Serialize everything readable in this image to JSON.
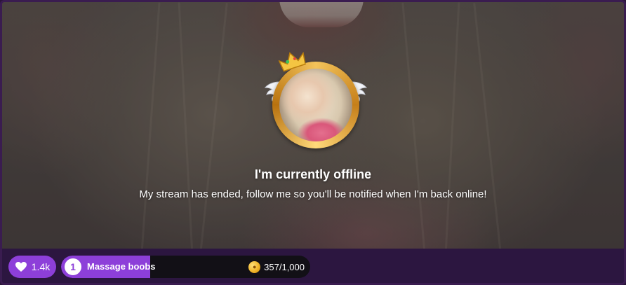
{
  "offline": {
    "title": "I'm currently offline",
    "message": "My stream has ended, follow me so you'll be notified when I'm back online!"
  },
  "likes": {
    "count": "1.4k",
    "icon": "heart-icon"
  },
  "goal": {
    "number": "1",
    "label": "Massage boobs",
    "progress_text": "357/1,000",
    "progress_fraction": 0.357,
    "coin_icon": "coin-icon"
  },
  "colors": {
    "accent": "#8d3fd9",
    "bar_bg": "#2c1640",
    "frame": "#3a1c50",
    "gold": "#f3c35a"
  }
}
